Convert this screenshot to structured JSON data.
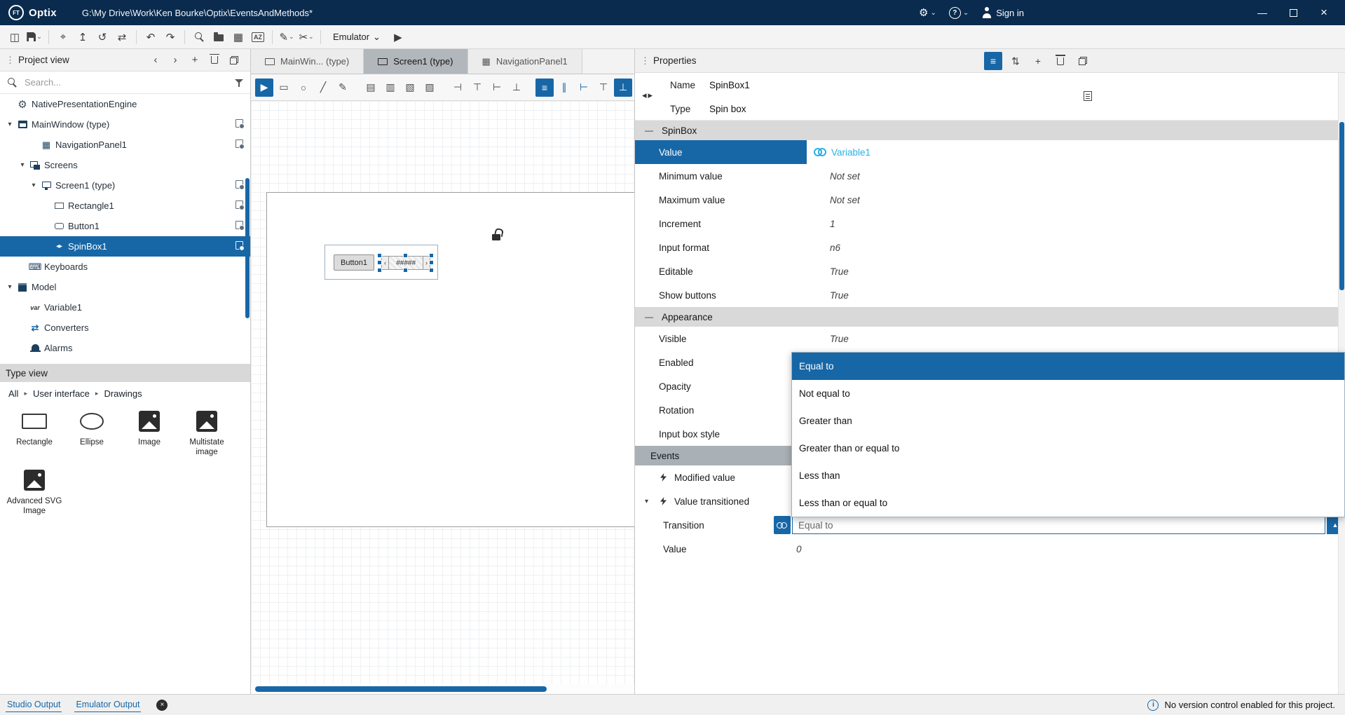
{
  "titlebar": {
    "logo_monogram": "FT",
    "app_name": "Optix",
    "path": "G:\\My Drive\\Work\\Ken Bourke\\Optix\\EventsAndMethods*",
    "sign_in_label": "Sign in"
  },
  "main_toolbar": {
    "emulator_label": "Emulator"
  },
  "project_view": {
    "title": "Project view",
    "search_placeholder": "Search...",
    "tree": [
      {
        "label": "NativePresentationEngine",
        "indent": 0,
        "expanded": null,
        "icon": "engine-gear",
        "badge": false,
        "selected": false
      },
      {
        "label": "MainWindow (type)",
        "indent": 0,
        "expanded": true,
        "icon": "main-window",
        "badge": true,
        "selected": false
      },
      {
        "label": "NavigationPanel1",
        "indent": 1,
        "expanded": null,
        "icon": "navigation-panel",
        "badge": true,
        "selected": false
      },
      {
        "label": "Screens",
        "indent": 1,
        "expanded": true,
        "icon": "screens-folder",
        "badge": false,
        "selected": false
      },
      {
        "label": "Screen1 (type)",
        "indent": 2,
        "expanded": true,
        "icon": "screen",
        "badge": true,
        "selected": false
      },
      {
        "label": "Rectangle1",
        "indent": 3,
        "expanded": null,
        "icon": "rectangle",
        "badge": true,
        "selected": false
      },
      {
        "label": "Button1",
        "indent": 3,
        "expanded": null,
        "icon": "button",
        "badge": true,
        "selected": false
      },
      {
        "label": "SpinBox1",
        "indent": 3,
        "expanded": null,
        "icon": "spinbox",
        "badge": true,
        "selected": true
      },
      {
        "label": "Keyboards",
        "indent": 1,
        "expanded": null,
        "icon": "keyboard",
        "badge": false,
        "selected": false
      },
      {
        "label": "Model",
        "indent": 0,
        "expanded": true,
        "icon": "model",
        "badge": false,
        "selected": false
      },
      {
        "label": "Variable1",
        "indent": 1,
        "expanded": null,
        "icon": "variable",
        "badge": false,
        "selected": false
      },
      {
        "label": "Converters",
        "indent": 1,
        "expanded": null,
        "icon": "converter",
        "badge": false,
        "selected": false
      },
      {
        "label": "Alarms",
        "indent": 1,
        "expanded": null,
        "icon": "alarm",
        "badge": false,
        "selected": false
      }
    ]
  },
  "type_view": {
    "title": "Type view",
    "breadcrumb": [
      "All",
      "User interface",
      "Drawings"
    ],
    "items": [
      {
        "label": "Rectangle"
      },
      {
        "label": "Ellipse"
      },
      {
        "label": "Image"
      },
      {
        "label": "Multistate image"
      },
      {
        "label": "Advanced SVG Image"
      }
    ]
  },
  "canvas": {
    "tabs": [
      {
        "label": "MainWin... (type)",
        "active": false
      },
      {
        "label": "Screen1 (type)",
        "active": true
      },
      {
        "label": "NavigationPanel1",
        "active": false
      }
    ],
    "button_label": "Button1",
    "spinbox_text": "#####"
  },
  "properties": {
    "title": "Properties",
    "name_label": "Name",
    "name_value": "SpinBox1",
    "type_label": "Type",
    "type_value": "Spin box",
    "sections": {
      "spinbox": {
        "title": "SpinBox",
        "rows": [
          {
            "label": "Value",
            "value": "Variable1",
            "linked": true,
            "selected": true
          },
          {
            "label": "Minimum value",
            "value": "Not set"
          },
          {
            "label": "Maximum value",
            "value": "Not set"
          },
          {
            "label": "Increment",
            "value": "1"
          },
          {
            "label": "Input format",
            "value": "n6"
          },
          {
            "label": "Editable",
            "value": "True"
          },
          {
            "label": "Show buttons",
            "value": "True"
          }
        ]
      },
      "appearance": {
        "title": "Appearance",
        "rows": [
          {
            "label": "Visible",
            "value": "True"
          },
          {
            "label": "Enabled",
            "value": ""
          },
          {
            "label": "Opacity",
            "value": ""
          },
          {
            "label": "Rotation",
            "value": ""
          },
          {
            "label": "Input box style",
            "value": ""
          }
        ]
      },
      "events": {
        "title": "Events",
        "rows": [
          {
            "label": "Modified value"
          },
          {
            "label": "Value transitioned",
            "expanded": true
          }
        ],
        "transition": {
          "label": "Transition",
          "value": "Equal to"
        },
        "event_value": {
          "label": "Value",
          "value": "0"
        }
      }
    },
    "dropdown": {
      "options": [
        "Equal to",
        "Not equal to",
        "Greater than",
        "Greater than or equal to",
        "Less than",
        "Less than or equal to"
      ],
      "selected_index": 0
    }
  },
  "statusbar": {
    "tabs": [
      "Studio Output",
      "Emulator Output"
    ],
    "message": "No version control enabled for this project."
  },
  "colors": {
    "titlebar_bg": "#0a2b4d",
    "accent_blue": "#1767a7",
    "link_cyan": "#29b0e4",
    "section_gray": "#d9d9d9",
    "events_gray": "#a9b0b6"
  },
  "icons": {
    "kebab": "⋮",
    "gear": "⚙",
    "help_q": "?",
    "chev_down": "⌄",
    "chev_left": "‹",
    "chev_right": "›",
    "minimize": "—",
    "close": "×",
    "play": "▶",
    "undo": "↶",
    "redo": "↷",
    "sync": "⇄",
    "target": "⌖",
    "upload": "↥",
    "download": "↧",
    "history": "↺",
    "table": "▦",
    "az": "AZ",
    "pen": "✎",
    "cut": "✂",
    "workspace": "◫",
    "plus": "+",
    "minus": "—",
    "exp_open": "▾",
    "crumb_sep": "▸",
    "rect_tool": "▭",
    "ellipse_tool": "○",
    "line_tool": "╱",
    "keyboard": "⌨",
    "spin_pair": "◂▸",
    "var_label": "var",
    "nav_grid": "▦",
    "drop_up": "▲",
    "info": "i",
    "cross": "×",
    "filter_lines": "≡",
    "sort": "⇅",
    "align_l": "⊣",
    "align_t": "⊤",
    "align_r": "⊢",
    "align_b": "⊥",
    "dist": "∥",
    "equal": "≡",
    "nav_left": "◂",
    "nav_right": "▸",
    "layer1": "▤",
    "layer2": "▥",
    "layer3": "▧",
    "layer4": "▨",
    "spin_left": "‹",
    "spin_right": "›"
  }
}
